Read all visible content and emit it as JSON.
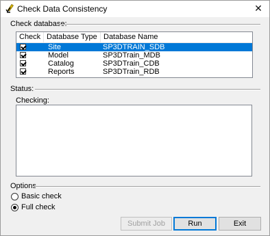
{
  "window": {
    "title": "Check Data Consistency",
    "close_glyph": "✕"
  },
  "check_database": {
    "label": "Check database:",
    "columns": [
      "Check",
      "Database Type",
      "Database Name"
    ],
    "rows": [
      {
        "checked": true,
        "type": "Site",
        "name": "SP3DTRAIN_SDB",
        "selected": true
      },
      {
        "checked": true,
        "type": "Model",
        "name": "SP3DTrain_MDB",
        "selected": false
      },
      {
        "checked": true,
        "type": "Catalog",
        "name": "SP3DTrain_CDB",
        "selected": false
      },
      {
        "checked": true,
        "type": "Reports",
        "name": "SP3DTrain_RDB",
        "selected": false
      }
    ]
  },
  "status": {
    "label": "Status:",
    "checking_label": "Checking:",
    "checking_text": ""
  },
  "options": {
    "label": "Options",
    "basic_check": "Basic check",
    "full_check": "Full check",
    "selected": "full_check"
  },
  "buttons": {
    "submit_job": "Submit Job",
    "run": "Run",
    "exit": "Exit"
  },
  "colors": {
    "selection": "#0078d7"
  },
  "icons": {
    "title_icon": "pencil-check-icon",
    "close": "close-icon"
  }
}
